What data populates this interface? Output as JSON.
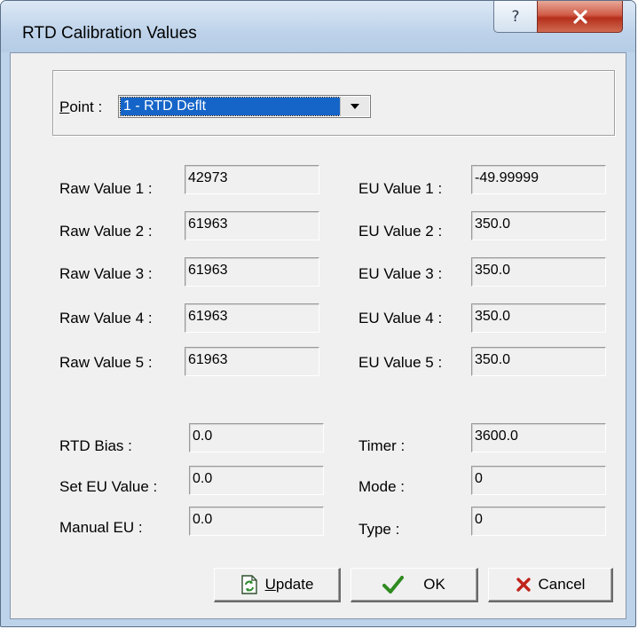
{
  "window": {
    "title": "RTD Calibration Values"
  },
  "titlebar": {
    "help_label": "?",
    "close_label": "X"
  },
  "point": {
    "label_prefix": "P",
    "label_rest": "oint :",
    "selected": "1 - RTD Deflt"
  },
  "raw_values": [
    {
      "label": "Raw Value 1 :",
      "value": "42973"
    },
    {
      "label": "Raw Value 2 :",
      "value": "61963"
    },
    {
      "label": "Raw Value 3 :",
      "value": "61963"
    },
    {
      "label": "Raw Value 4 :",
      "value": "61963"
    },
    {
      "label": "Raw Value 5 :",
      "value": "61963"
    }
  ],
  "eu_values": [
    {
      "label": "EU Value 1 :",
      "value": "-49.99999"
    },
    {
      "label": "EU Value 2 :",
      "value": "350.0"
    },
    {
      "label": "EU Value 3 :",
      "value": "350.0"
    },
    {
      "label": "EU Value 4 :",
      "value": "350.0"
    },
    {
      "label": "EU Value 5 :",
      "value": "350.0"
    }
  ],
  "rtd_bias": {
    "label": "RTD Bias :",
    "value": "0.0"
  },
  "set_eu_value": {
    "label": "Set EU Value :",
    "value": "0.0"
  },
  "manual_eu": {
    "label": "Manual EU :",
    "value": "0.0"
  },
  "timer": {
    "label": "Timer :",
    "value": "3600.0"
  },
  "mode": {
    "label": "Mode :",
    "value": "0"
  },
  "type": {
    "label": "Type :",
    "value": "0"
  },
  "buttons": {
    "update_prefix": "U",
    "update_rest": "pdate",
    "ok": "OK",
    "cancel": "Cancel"
  },
  "icons": {
    "help": "help-icon",
    "close": "close-icon",
    "dropdown": "chevron-down-icon",
    "update": "refresh-icon",
    "ok": "checkmark-icon",
    "cancel": "x-mark-icon"
  },
  "colors": {
    "selection": "#1565c8",
    "ok_check": "#2e8b1e",
    "cancel_x": "#c0241a",
    "close_button": "#c94a36"
  }
}
